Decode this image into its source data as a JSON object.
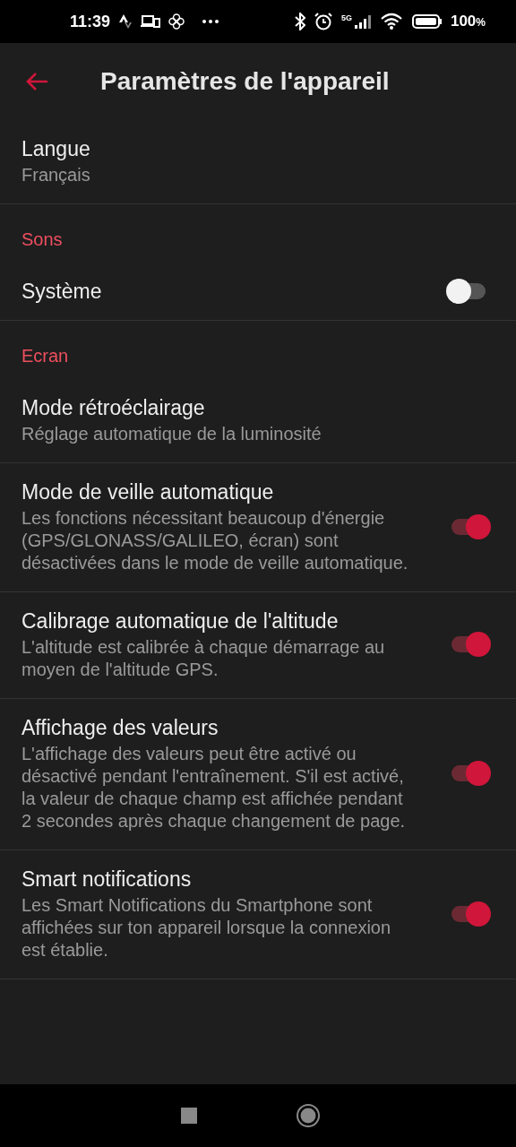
{
  "status_bar": {
    "time": "11:39",
    "network": "5G",
    "battery": "100",
    "battery_unit": "%"
  },
  "header": {
    "title": "Paramètres de l'appareil"
  },
  "items": [
    {
      "kind": "setting",
      "title": "Langue",
      "description": "Français"
    },
    {
      "kind": "section",
      "title": "Sons"
    },
    {
      "kind": "toggle",
      "title": "Système",
      "on": false
    },
    {
      "kind": "section",
      "title": "Ecran"
    },
    {
      "kind": "setting",
      "title": "Mode rétroéclairage",
      "description": "Réglage automatique de la luminosité"
    },
    {
      "kind": "toggle",
      "title": "Mode de veille automatique",
      "description": "Les fonctions nécessitant beaucoup d'énergie (GPS/GLONASS/GALILEO, écran) sont désactivées dans le mode de veille automatique.",
      "on": true
    },
    {
      "kind": "toggle",
      "title": "Calibrage automatique de l'altitude",
      "description": "L'altitude est calibrée à chaque démarrage au moyen de l'altitude GPS.",
      "on": true
    },
    {
      "kind": "toggle",
      "title": "Affichage des valeurs",
      "description": "L'affichage des valeurs peut être activé ou désactivé pendant l'entraînement. S'il est activé, la valeur de chaque champ est affichée pendant 2 secondes après chaque changement de page.",
      "on": true
    },
    {
      "kind": "toggle",
      "title": "Smart notifications",
      "description": "Les Smart Notifications du Smartphone sont affichées sur ton appareil lorsque la connexion est établie.",
      "on": true
    }
  ]
}
